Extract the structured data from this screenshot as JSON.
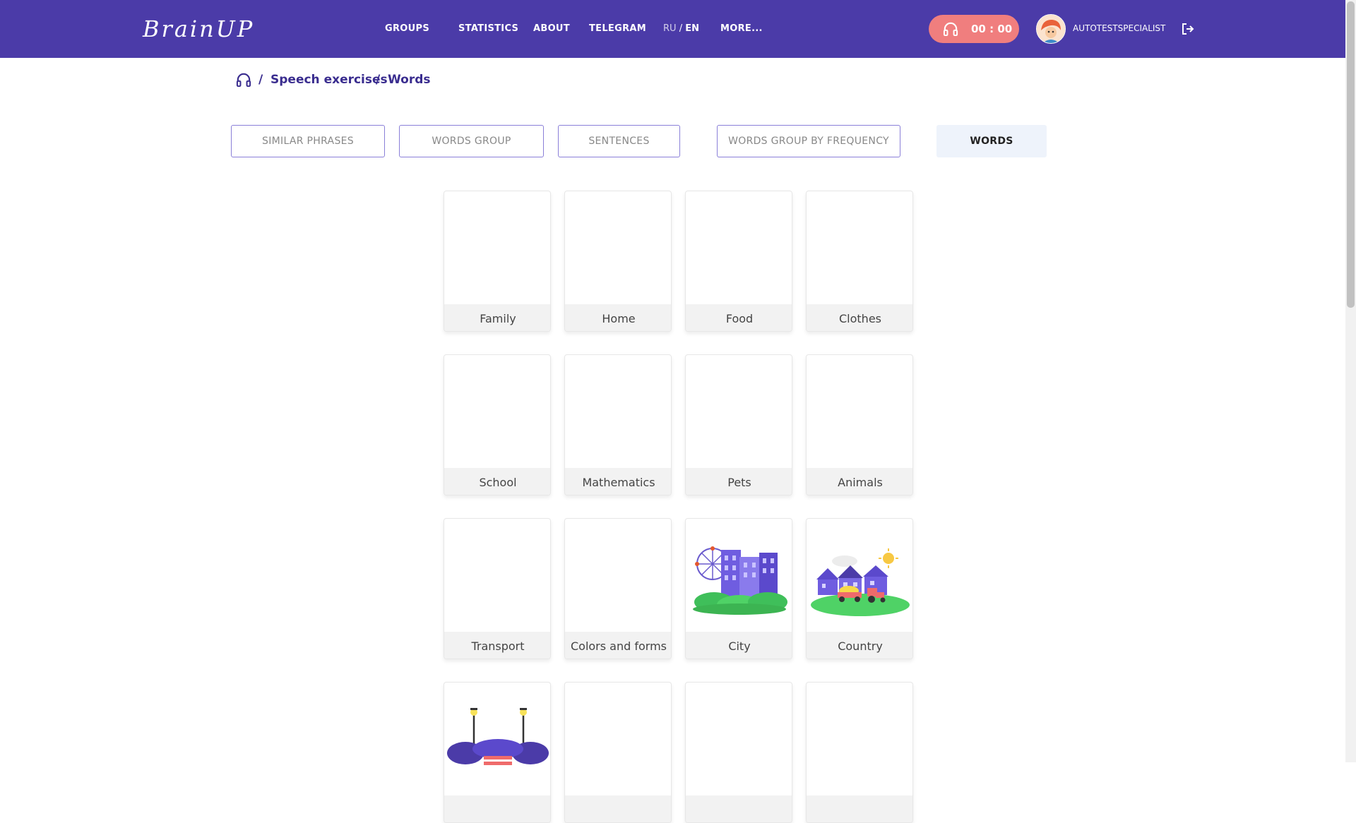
{
  "header": {
    "logo": "BrainUP",
    "nav": [
      "GROUPS",
      "STATISTICS",
      "ABOUT",
      "TELEGRAM"
    ],
    "lang_ru": "RU",
    "lang_sep": " / ",
    "lang_en": "EN",
    "more": "MORE...",
    "timer": "00 : 00",
    "username": "AUTOTESTSPECIALIST",
    "colors": {
      "bar": "#4b3ba8",
      "timer": "#f07e7e"
    }
  },
  "breadcrumb": {
    "home_icon": "headphones-icon",
    "sep": "/",
    "level1": "Speech exercises",
    "level2": "Words"
  },
  "tabs": [
    "SIMILAR PHRASES",
    "WORDS GROUP",
    "SENTENCES",
    "WORDS GROUP BY FREQUENCY",
    "WORDS"
  ],
  "active_tab": "WORDS",
  "cards": [
    "Family",
    "Home",
    "Food",
    "Clothes",
    "School",
    "Mathematics",
    "Pets",
    "Animals",
    "Transport",
    "Colors and forms",
    "City",
    "Country",
    "",
    "",
    "",
    ""
  ]
}
